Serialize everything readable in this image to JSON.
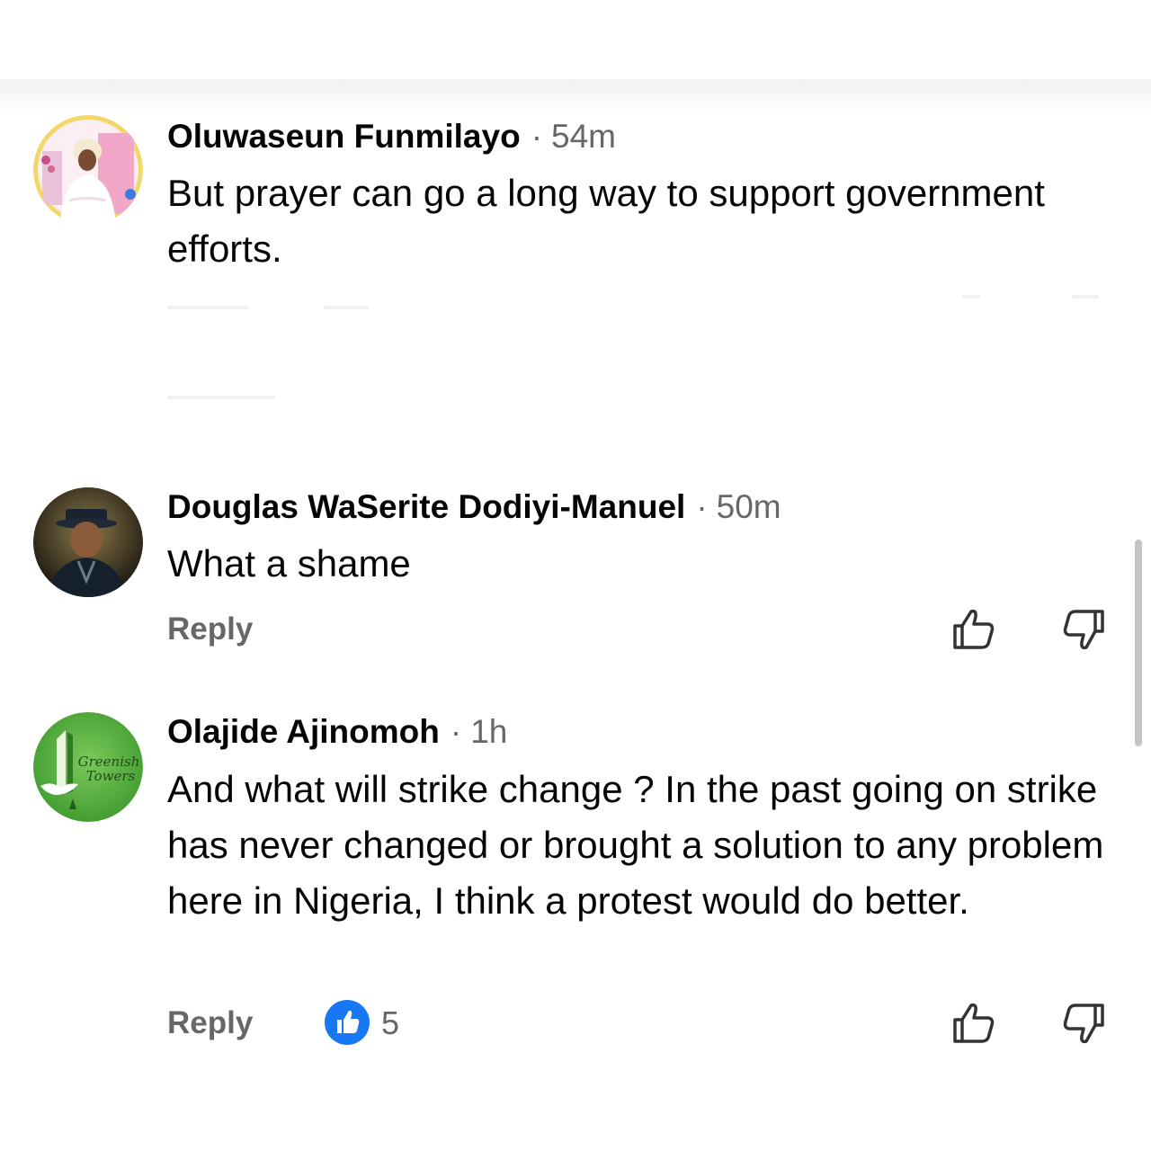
{
  "comments": [
    {
      "author": "Oluwaseun Funmilayo",
      "separator": "·",
      "time": "54m",
      "text": "But prayer can go a long way to support government efforts.",
      "avatar": "portrait-photo"
    },
    {
      "author": "Douglas WaSerite Dodiyi-Manuel",
      "separator": "·",
      "time": "50m",
      "text": "What a shame",
      "reply_label": "Reply",
      "avatar": "portrait-photo"
    },
    {
      "author": "Olajide Ajinomoh",
      "separator": "·",
      "time": "1h",
      "text": "And what will strike change ? In the past going on strike has never changed or brought a solution to any problem here in Nigeria, I think a protest would do better.",
      "reply_label": "Reply",
      "like_count": "5",
      "avatar": "greenish-towers-logo",
      "avatar_logo_text": [
        "Greenish",
        "Towers"
      ]
    }
  ],
  "colors": {
    "text": "#050505",
    "secondary": "#65676b",
    "like_blue": "#1877f2",
    "logo_green": "#4caf3d"
  }
}
